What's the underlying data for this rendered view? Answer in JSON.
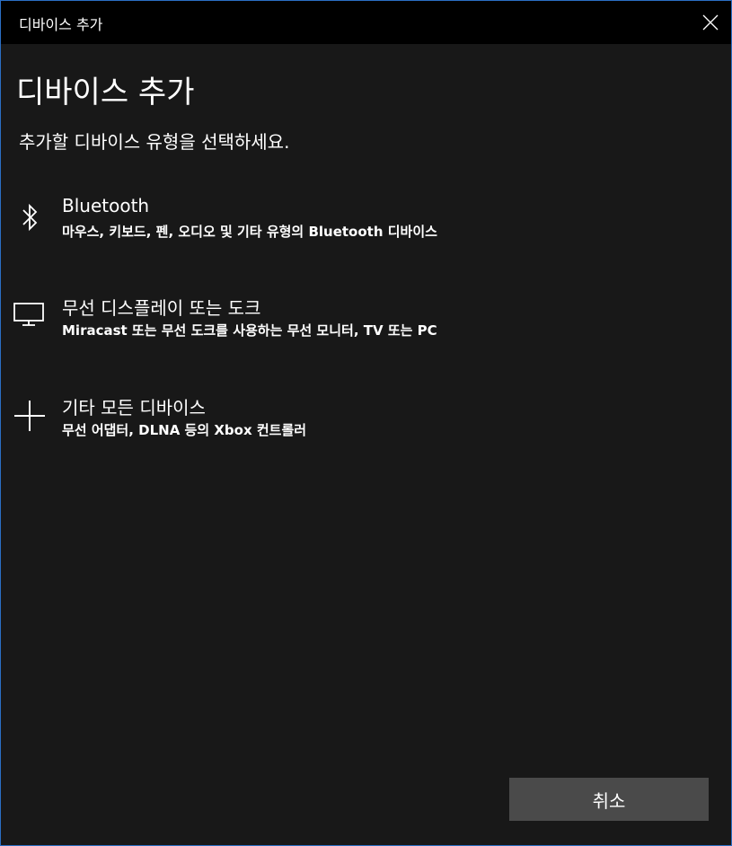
{
  "window": {
    "title": "디바이스 추가",
    "close_icon": "close-icon"
  },
  "main": {
    "heading": "디바이스 추가",
    "subheading": "추가할 디바이스 유형을 선택하세요."
  },
  "options": [
    {
      "icon": "bluetooth-icon",
      "title": "Bluetooth",
      "description": "마우스, 키보드, 펜, 오디오 및 기타 유형의 Bluetooth 디바이스"
    },
    {
      "icon": "monitor-icon",
      "title": "무선 디스플레이 또는 도크",
      "description": "Miracast 또는 무선 도크를 사용하는 무선 모니터, TV 또는 PC"
    },
    {
      "icon": "plus-icon",
      "title": "기타 모든 디바이스",
      "description": "무선 어댑터, DLNA 등의 Xbox 컨트롤러"
    }
  ],
  "footer": {
    "cancel_label": "취소"
  },
  "colors": {
    "background": "#181818",
    "titlebar": "#000000",
    "border": "#2b6ec4",
    "button": "#4a4a4a",
    "text": "#ffffff"
  }
}
